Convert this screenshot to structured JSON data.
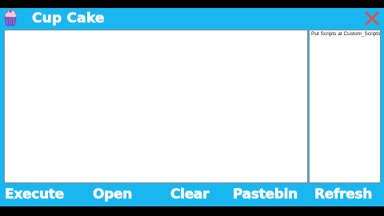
{
  "window": {
    "title": "Cup Cake",
    "logo": "cupcake-icon",
    "close_icon": "close-icon",
    "accent_color": "#1ab6f0",
    "close_color": "#d9534f"
  },
  "editor": {
    "value": ""
  },
  "scripts": {
    "items": [
      "Put Scripts at Custom_Scripts folder"
    ]
  },
  "toolbar": {
    "execute_label": "Execute",
    "open_label": "Open",
    "clear_label": "Clear",
    "pastebin_label": "Pastebin",
    "refresh_label": "Refresh"
  }
}
